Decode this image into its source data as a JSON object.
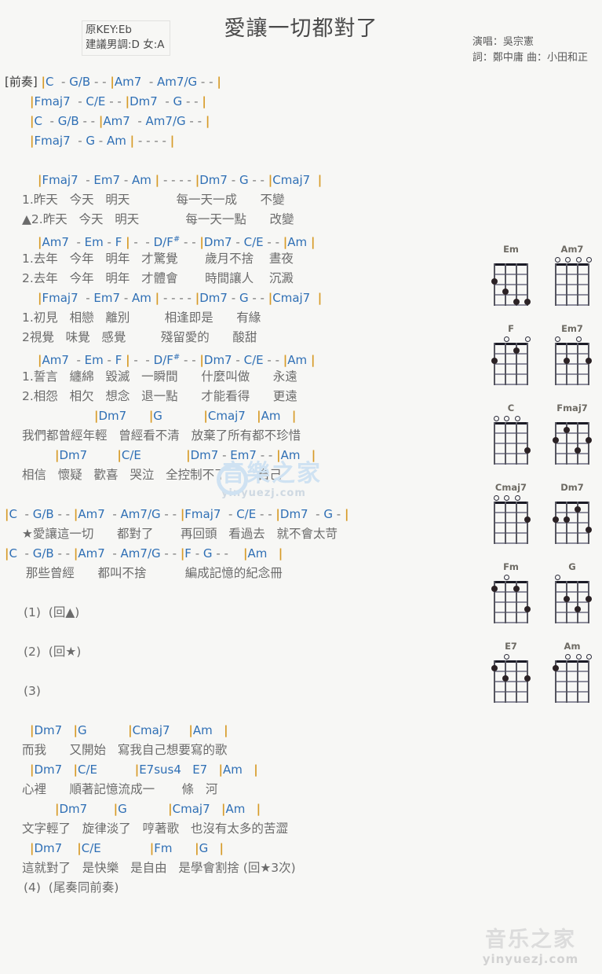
{
  "header": {
    "title": "愛讓一切都對了",
    "key_original": "原KEY:Eb",
    "key_suggested": "建議男調:D 女:A",
    "singer": "演唱：吳宗憲",
    "writers": "詞：鄭中庸  曲：小田和正"
  },
  "watermark": {
    "center_text": "音樂之家",
    "center_sub": "yinyuezj.com",
    "bottom_text": "音乐之家",
    "bottom_sub": "yinyuezj.com"
  },
  "sections": [
    {
      "type": "chord",
      "indent": 0,
      "label": "[前奏]",
      "text": "|C  - G/B - - |Am7  - Am7/G - - |"
    },
    {
      "type": "chord",
      "indent": 1,
      "label": "",
      "text": "|Fmaj7  - C/E - - |Dm7  - G - - |"
    },
    {
      "type": "chord",
      "indent": 1,
      "label": "",
      "text": "|C  - G/B - - |Am7  - Am7/G - - |"
    },
    {
      "type": "chord",
      "indent": 1,
      "label": "",
      "text": "|Fmaj7  - G - Am | - - - - |"
    },
    {
      "type": "chord",
      "indent": 2,
      "label": "",
      "text": "|Fmaj7  - Em7 - Am | - - - - |Dm7 - G - - |Cmaj7  |"
    },
    {
      "type": "lyric",
      "text": "1.昨天   今天   明天            每一天一成      不變"
    },
    {
      "type": "lyric",
      "text": "▲2.昨天   今天   明天            每一天一點      改變"
    },
    {
      "type": "chord",
      "indent": 2,
      "label": "",
      "text": "|Am7  - Em - F | -  - D/F# - - |Dm7 - C/E - - |Am |"
    },
    {
      "type": "lyric",
      "text": "1.去年   今年   明年   才驚覺       歲月不捨    晝夜"
    },
    {
      "type": "lyric",
      "text": "2.去年   今年   明年   才體會       時間讓人    沉澱"
    },
    {
      "type": "chord",
      "indent": 2,
      "label": "",
      "text": "|Fmaj7  - Em7 - Am | - - - - |Dm7 - G - - |Cmaj7  |"
    },
    {
      "type": "lyric",
      "text": "1.初見   相戀   離別         相逢即是      有緣"
    },
    {
      "type": "lyric",
      "text": "2視覺   味覺   感覺         殘留愛的      酸甜"
    },
    {
      "type": "chord",
      "indent": 2,
      "label": "",
      "text": "|Am7  - Em - F | -  - D/F# - - |Dm7 - C/E - - |Am |"
    },
    {
      "type": "lyric",
      "text": "1.誓言   纏綿   毀滅   一瞬間      什麼叫做      永遠"
    },
    {
      "type": "lyric",
      "text": "2.相怨   相欠   想念   退一點      才能看得      更遠"
    },
    {
      "type": "chord",
      "indent": 5,
      "label": "",
      "text": "|Dm7      |G           |Cmaj7   |Am   |"
    },
    {
      "type": "lyric",
      "text": "我們都曾經年輕   曾經看不清   放棄了所有都不珍惜"
    },
    {
      "type": "chord",
      "indent": 3,
      "label": "",
      "text": "|Dm7        |C/E            |Dm7 - Em7 - - |Am   |"
    },
    {
      "type": "lyric",
      "text": "相信   懷疑   歡喜   哭泣   全控制不了        自己"
    },
    {
      "type": "chord",
      "indent": 0,
      "label": "",
      "text": "|C  - G/B - - |Am7  - Am7/G - - |Fmaj7  - C/E - - |Dm7  - G - |"
    },
    {
      "type": "lyric",
      "text": "★愛讓這一切      都對了       再回頭   看過去   就不會太苛"
    },
    {
      "type": "chord",
      "indent": 0,
      "label": "",
      "text": "|C  - G/B - - |Am7  - Am7/G - - |F - G - -    |Am   |"
    },
    {
      "type": "lyric",
      "text": " 那些曾經      都叫不捨          編成記憶的紀念冊"
    },
    {
      "type": "note",
      "text": "(1)  (回▲)"
    },
    {
      "type": "note",
      "text": "(2)  (回★)"
    },
    {
      "type": "note",
      "text": "(3)"
    },
    {
      "type": "chord",
      "indent": 1,
      "label": "",
      "text": "|Dm7   |G           |Cmaj7     |Am   |"
    },
    {
      "type": "lyric",
      "text": "而我      又開始   寫我自己想要寫的歌"
    },
    {
      "type": "chord",
      "indent": 1,
      "label": "",
      "text": "|Dm7   |C/E          |E7sus4   E7   |Am   |"
    },
    {
      "type": "lyric",
      "text": "心裡      順著記憶流成一       條   河"
    },
    {
      "type": "chord",
      "indent": 3,
      "label": "",
      "text": "|Dm7       |G           |Cmaj7   |Am   |"
    },
    {
      "type": "lyric",
      "text": "文字輕了   旋律淡了   哼著歌   也沒有太多的苦澀"
    },
    {
      "type": "chord",
      "indent": 1,
      "label": "",
      "text": "|Dm7    |C/E             |Fm      |G   |"
    },
    {
      "type": "lyric",
      "text": "這就對了   是快樂   是自由   是學會割捨 (回★3次)"
    },
    {
      "type": "note",
      "text": "(4)  (尾奏同前奏)"
    }
  ],
  "chord_diagrams": [
    {
      "name": "Em",
      "open": [],
      "dots": [
        {
          "s": 4,
          "f": 2
        },
        {
          "s": 3,
          "f": 3
        },
        {
          "s": 2,
          "f": 4
        },
        {
          "s": 1,
          "f": 4
        }
      ]
    },
    {
      "name": "Am7",
      "open": [
        1,
        2,
        3,
        4
      ],
      "dots": []
    },
    {
      "name": "F",
      "open": [
        3,
        1
      ],
      "dots": [
        {
          "s": 4,
          "f": 2
        },
        {
          "s": 2,
          "f": 1
        }
      ]
    },
    {
      "name": "Em7",
      "open": [
        4,
        2
      ],
      "dots": [
        {
          "s": 3,
          "f": 2
        },
        {
          "s": 1,
          "f": 2
        }
      ]
    },
    {
      "name": "C",
      "open": [
        4,
        3,
        2
      ],
      "dots": [
        {
          "s": 1,
          "f": 3
        }
      ]
    },
    {
      "name": "Fmaj7",
      "open": [],
      "dots": [
        {
          "s": 4,
          "f": 2
        },
        {
          "s": 3,
          "f": 1
        },
        {
          "s": 2,
          "f": 3
        },
        {
          "s": 1,
          "f": 2
        }
      ]
    },
    {
      "name": "Cmaj7",
      "open": [
        4,
        3,
        2
      ],
      "dots": [
        {
          "s": 1,
          "f": 2
        }
      ]
    },
    {
      "name": "Dm7",
      "open": [],
      "dots": [
        {
          "s": 4,
          "f": 2
        },
        {
          "s": 3,
          "f": 2
        },
        {
          "s": 2,
          "f": 1
        },
        {
          "s": 1,
          "f": 3
        }
      ]
    },
    {
      "name": "Fm",
      "open": [
        3
      ],
      "dots": [
        {
          "s": 4,
          "f": 1
        },
        {
          "s": 2,
          "f": 1
        },
        {
          "s": 1,
          "f": 3
        }
      ]
    },
    {
      "name": "G",
      "open": [
        4
      ],
      "dots": [
        {
          "s": 3,
          "f": 2
        },
        {
          "s": 2,
          "f": 3
        },
        {
          "s": 1,
          "f": 2
        }
      ]
    },
    {
      "name": "E7",
      "open": [
        3
      ],
      "dots": [
        {
          "s": 4,
          "f": 1
        },
        {
          "s": 3,
          "f": 2
        },
        {
          "s": 1,
          "f": 2
        }
      ]
    },
    {
      "name": "Am",
      "open": [
        3,
        2,
        1
      ],
      "dots": [
        {
          "s": 4,
          "f": 1
        }
      ]
    }
  ]
}
